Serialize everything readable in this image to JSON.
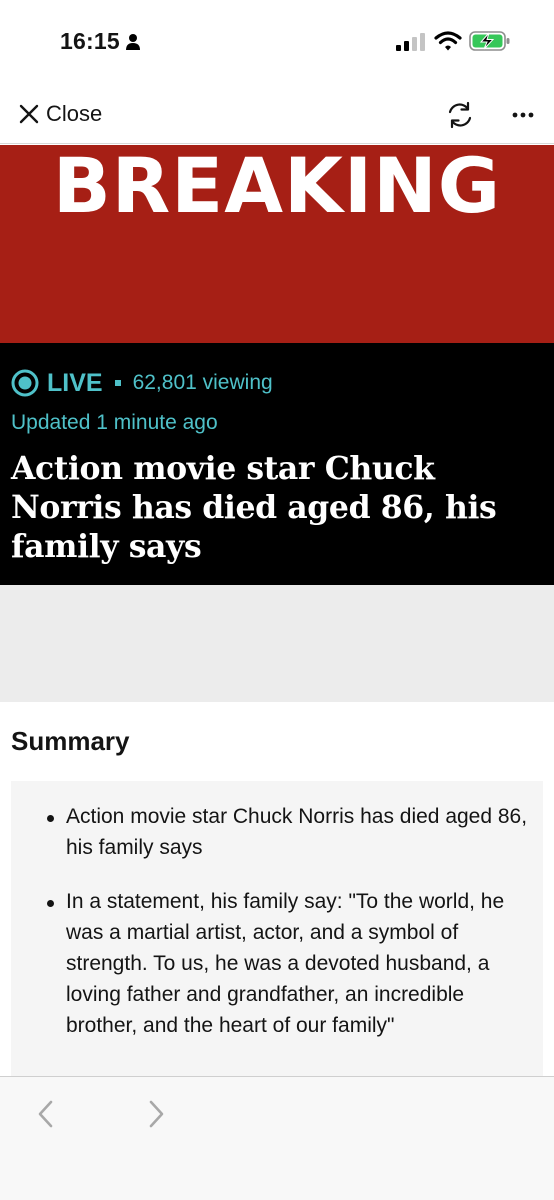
{
  "status_bar": {
    "time": "16:15",
    "icons": [
      "person-icon",
      "signal-icon",
      "wifi-icon",
      "battery-charging-icon"
    ]
  },
  "nav": {
    "close_label": "Close",
    "icons": [
      "close-icon",
      "refresh-icon",
      "more-icon"
    ]
  },
  "banner": {
    "text": "BREAKING"
  },
  "live": {
    "label": "LIVE",
    "viewing": "62,801 viewing",
    "updated": "Updated 1 minute ago",
    "headline": "Action movie star Chuck Norris has died aged 86, his family says"
  },
  "summary": {
    "title": "Summary",
    "items": [
      "Action movie star Chuck Norris has died aged 86, his family says",
      "In a statement, his family say: \"To the world, he was a martial artist, actor, and a symbol of strength. To us, he was a devoted husband, a loving father and grandfather, an incredible brother, and the heart of our family\""
    ]
  },
  "toolbar": {
    "icons": [
      "back-chevron-icon",
      "forward-chevron-icon"
    ]
  },
  "colors": {
    "breaking_red": "#a61f15",
    "live_teal": "#4fc1c9",
    "header_black": "#000000",
    "summary_bg": "#f5f5f5",
    "battery_green": "#36c759"
  }
}
